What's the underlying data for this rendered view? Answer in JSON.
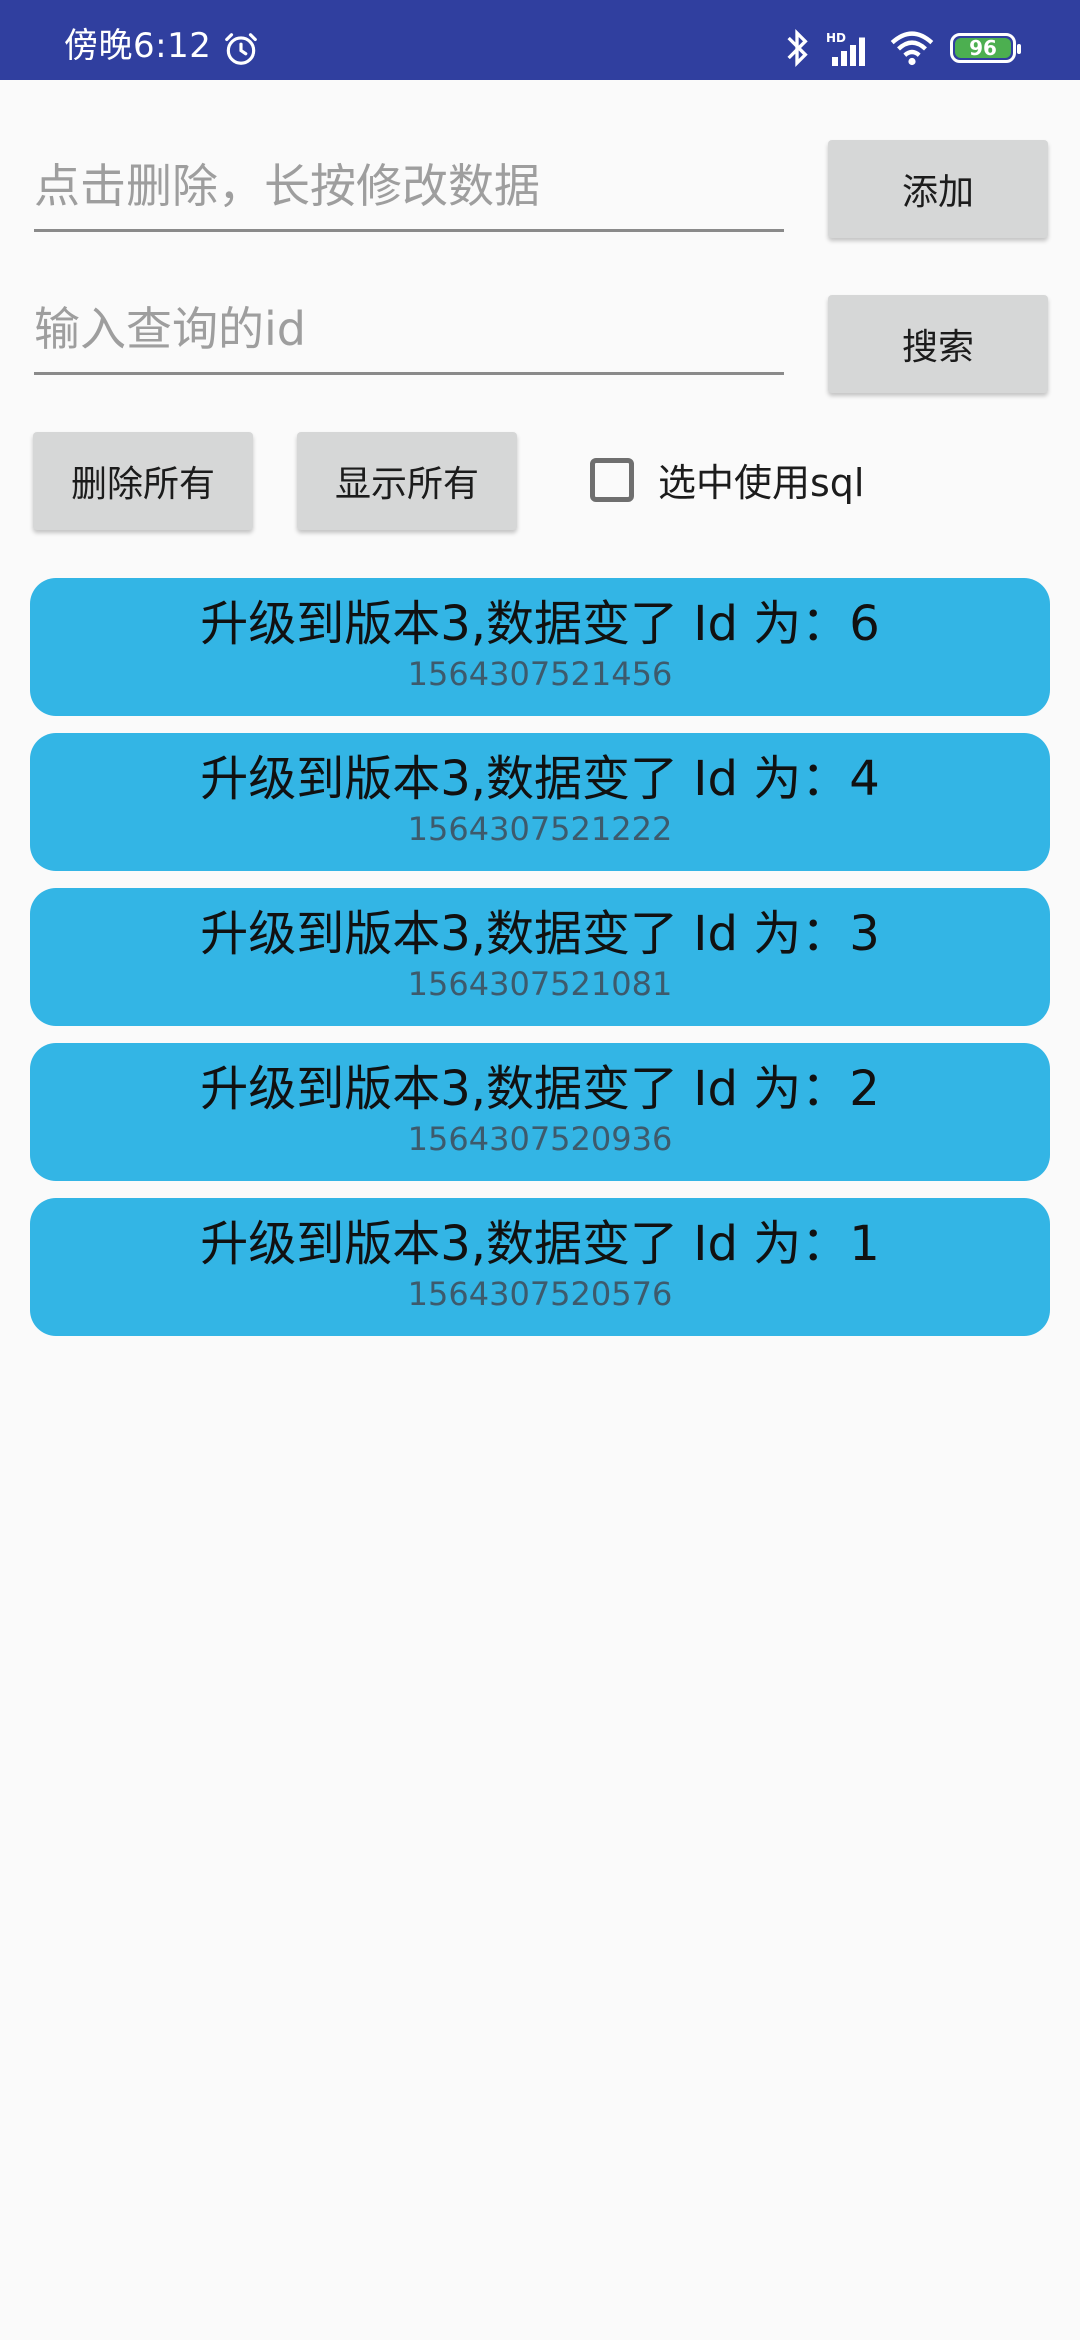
{
  "status_bar": {
    "time": "傍晚6:12",
    "battery": "96",
    "icons": [
      "alarm-icon",
      "bluetooth-icon",
      "hd-signal-icon",
      "wifi-icon",
      "battery-icon"
    ]
  },
  "form": {
    "data_input": {
      "placeholder": "点击删除，长按修改数据",
      "value": ""
    },
    "add_button": "添加",
    "id_input": {
      "placeholder": "输入查询的id",
      "value": ""
    },
    "search_button": "搜索",
    "delete_all_button": "删除所有",
    "show_all_button": "显示所有",
    "use_sql_checkbox": {
      "label": "选中使用sql",
      "checked": false
    }
  },
  "list": {
    "items": [
      {
        "title": "升级到版本3,数据变了 Id 为：6",
        "timestamp": "1564307521456"
      },
      {
        "title": "升级到版本3,数据变了 Id 为：4",
        "timestamp": "1564307521222"
      },
      {
        "title": "升级到版本3,数据变了 Id 为：3",
        "timestamp": "1564307521081"
      },
      {
        "title": "升级到版本3,数据变了 Id 为：2",
        "timestamp": "1564307520936"
      },
      {
        "title": "升级到版本3,数据变了 Id 为：1",
        "timestamp": "1564307520576"
      }
    ]
  },
  "colors": {
    "status_bar": "#303f9f",
    "list_item": "#33b5e5",
    "button": "#d6d7d7",
    "background": "#fafafa"
  }
}
